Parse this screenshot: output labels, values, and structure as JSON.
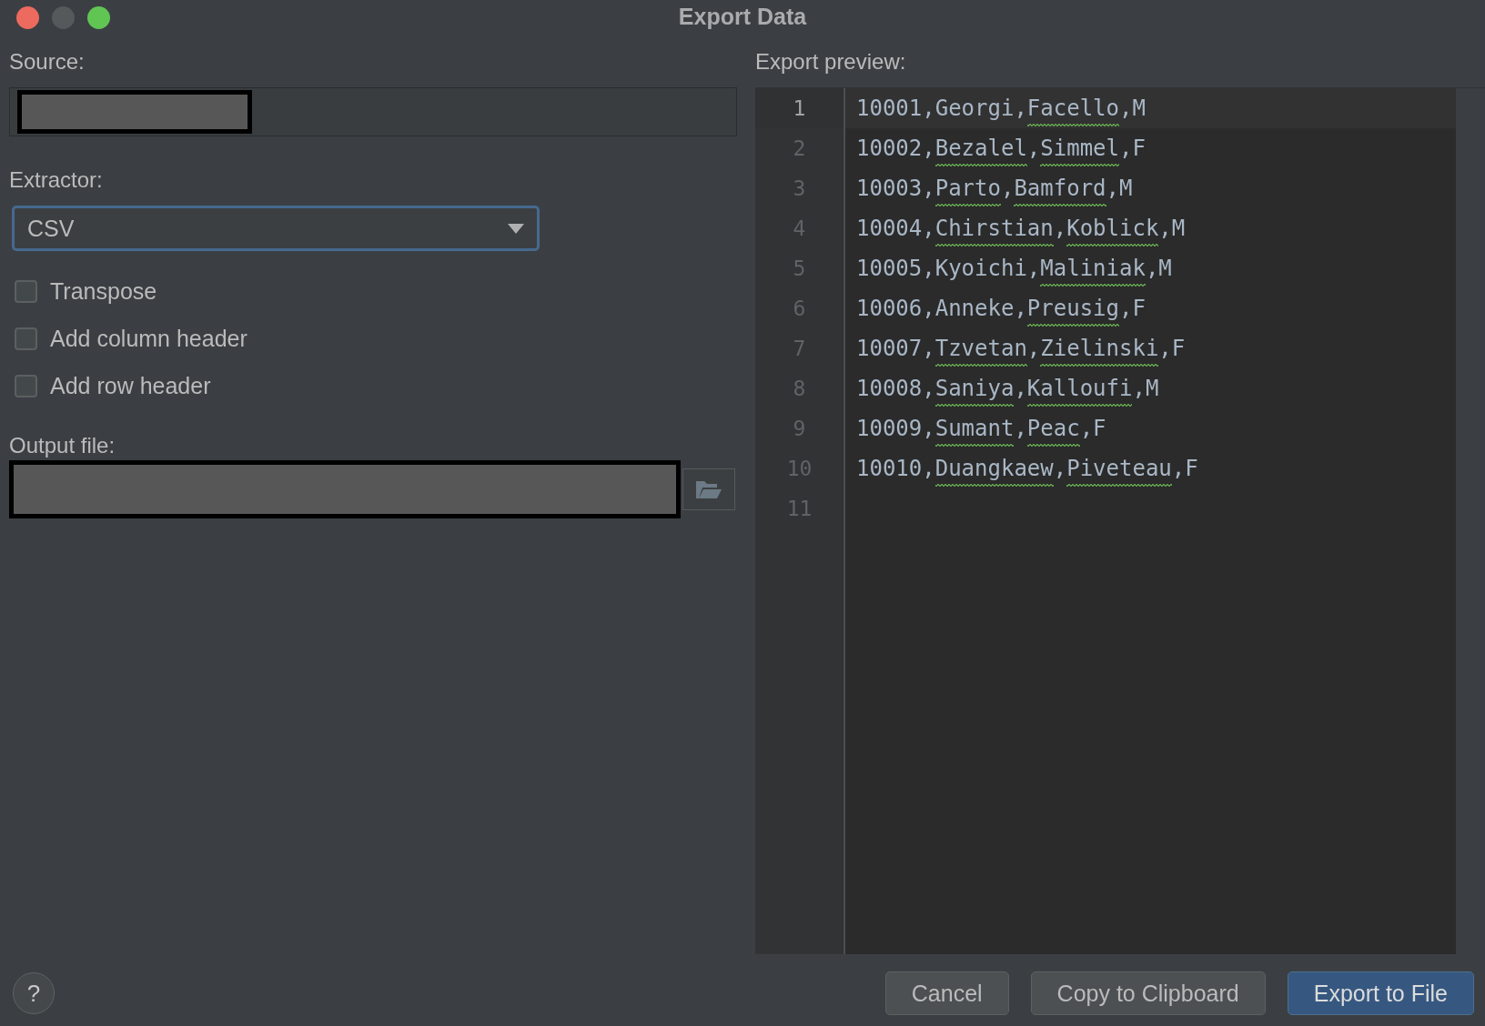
{
  "window": {
    "title": "Export Data"
  },
  "source": {
    "label": "Source:"
  },
  "extractor": {
    "label": "Extractor:",
    "value": "CSV",
    "focused": true
  },
  "options": [
    {
      "label": "Transpose",
      "checked": false
    },
    {
      "label": "Add column header",
      "checked": false
    },
    {
      "label": "Add row header",
      "checked": false
    }
  ],
  "output_file": {
    "label": "Output file:"
  },
  "preview": {
    "label": "Export preview:",
    "lines": [
      {
        "number": "1",
        "current": true,
        "parts": [
          {
            "text": "10001,Georgi,",
            "misspelled": false
          },
          {
            "text": "Facello",
            "misspelled": true
          },
          {
            "text": ",M",
            "misspelled": false
          }
        ]
      },
      {
        "number": "2",
        "current": false,
        "parts": [
          {
            "text": "10002,",
            "misspelled": false
          },
          {
            "text": "Bezalel",
            "misspelled": true
          },
          {
            "text": ",",
            "misspelled": false
          },
          {
            "text": "Simmel",
            "misspelled": true
          },
          {
            "text": ",F",
            "misspelled": false
          }
        ]
      },
      {
        "number": "3",
        "current": false,
        "parts": [
          {
            "text": "10003,",
            "misspelled": false
          },
          {
            "text": "Parto",
            "misspelled": true
          },
          {
            "text": ",",
            "misspelled": false
          },
          {
            "text": "Bamford",
            "misspelled": true
          },
          {
            "text": ",M",
            "misspelled": false
          }
        ]
      },
      {
        "number": "4",
        "current": false,
        "parts": [
          {
            "text": "10004,",
            "misspelled": false
          },
          {
            "text": "Chirstian",
            "misspelled": true
          },
          {
            "text": ",",
            "misspelled": false
          },
          {
            "text": "Koblick",
            "misspelled": true
          },
          {
            "text": ",M",
            "misspelled": false
          }
        ]
      },
      {
        "number": "5",
        "current": false,
        "parts": [
          {
            "text": "10005,Kyoichi,",
            "misspelled": false
          },
          {
            "text": "Maliniak",
            "misspelled": true
          },
          {
            "text": ",M",
            "misspelled": false
          }
        ]
      },
      {
        "number": "6",
        "current": false,
        "parts": [
          {
            "text": "10006,Anneke,",
            "misspelled": false
          },
          {
            "text": "Preusig",
            "misspelled": true
          },
          {
            "text": ",F",
            "misspelled": false
          }
        ]
      },
      {
        "number": "7",
        "current": false,
        "parts": [
          {
            "text": "10007,",
            "misspelled": false
          },
          {
            "text": "Tzvetan",
            "misspelled": true
          },
          {
            "text": ",",
            "misspelled": false
          },
          {
            "text": "Zielinski",
            "misspelled": true
          },
          {
            "text": ",F",
            "misspelled": false
          }
        ]
      },
      {
        "number": "8",
        "current": false,
        "parts": [
          {
            "text": "10008,",
            "misspelled": false
          },
          {
            "text": "Saniya",
            "misspelled": true
          },
          {
            "text": ",",
            "misspelled": false
          },
          {
            "text": "Kalloufi",
            "misspelled": true
          },
          {
            "text": ",M",
            "misspelled": false
          }
        ]
      },
      {
        "number": "9",
        "current": false,
        "parts": [
          {
            "text": "10009,",
            "misspelled": false
          },
          {
            "text": "Sumant",
            "misspelled": true
          },
          {
            "text": ",",
            "misspelled": false
          },
          {
            "text": "Peac",
            "misspelled": true
          },
          {
            "text": ",F",
            "misspelled": false
          }
        ]
      },
      {
        "number": "10",
        "current": false,
        "parts": [
          {
            "text": "10010,",
            "misspelled": false
          },
          {
            "text": "Duangkaew",
            "misspelled": true
          },
          {
            "text": ",",
            "misspelled": false
          },
          {
            "text": "Piveteau",
            "misspelled": true
          },
          {
            "text": ",F",
            "misspelled": false
          }
        ]
      },
      {
        "number": "11",
        "current": false
      }
    ]
  },
  "help": {
    "label": "?"
  },
  "buttons": [
    {
      "label": "Cancel",
      "kind": "secondary"
    },
    {
      "label": "Copy to Clipboard",
      "kind": "secondary"
    },
    {
      "label": "Export to File",
      "kind": "primary"
    }
  ]
}
